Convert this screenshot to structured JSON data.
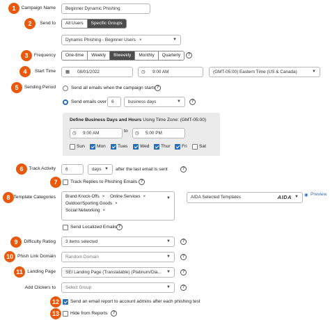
{
  "labels": {
    "campaign_name": "Campaign Name",
    "send_to": "Send to",
    "frequency": "Frequency",
    "start_time": "Start Time",
    "sending_period": "Sending Period",
    "track_activity": "Track Activity",
    "template_categories": "Template Categories",
    "difficulty_rating": "Difficulty Rating",
    "phish_link_domain": "Phish Link Domain",
    "landing_page": "Landing Page",
    "add_clickers_to": "Add Clickers to"
  },
  "badges": [
    "1",
    "2",
    "3",
    "4",
    "5",
    "6",
    "7",
    "8",
    "9",
    "10",
    "11",
    "12",
    "13"
  ],
  "campaign_name": {
    "value": "Beginner Dynamic Phishing"
  },
  "send_to": {
    "options": [
      "All Users",
      "Specific Groups"
    ],
    "selected": "Specific Groups",
    "group_chip": "Dynamic Phishing - Beginner Users",
    "remove_glyph": "×"
  },
  "frequency": {
    "options": [
      "One-time",
      "Weekly",
      "Biweekly",
      "Monthly",
      "Quarterly"
    ],
    "selected": "Biweekly"
  },
  "help_glyph": "?",
  "start_time": {
    "date": "08/01/2022",
    "time": "9:00 AM",
    "timezone": "(GMT-05:00) Eastern Time (US & Canada)"
  },
  "sending_period": {
    "option_all": "Send all emails when the campaign starts",
    "option_over": "Send emails over",
    "over_value": "6",
    "unit": "business days",
    "panel_title": "Define Business Days and Hours",
    "panel_timezone": "Using Time Zone: (GMT-05:00)",
    "from_time": "9:00 AM",
    "to_label": "to",
    "to_time": "5:00 PM",
    "days": [
      {
        "label": "Sun",
        "checked": false
      },
      {
        "label": "Mon",
        "checked": true
      },
      {
        "label": "Tues",
        "checked": true
      },
      {
        "label": "Wed",
        "checked": true
      },
      {
        "label": "Thur",
        "checked": true
      },
      {
        "label": "Fri",
        "checked": true
      },
      {
        "label": "Sat",
        "checked": false
      }
    ]
  },
  "track_activity": {
    "value": "6",
    "unit": "days",
    "suffix": "after the last email is sent"
  },
  "track_replies": {
    "label": "Track Replies to Phishing Emails"
  },
  "template_categories": {
    "chips": [
      "Brand Knock-Offs",
      "Online Services",
      "Outdoor/Sporting Goods",
      "Social Networking"
    ],
    "aida_label": "AIDA Selected Templates",
    "aida_logo": "AIDA",
    "preview": "Preview"
  },
  "send_localized": {
    "label": "Send Localized Emails"
  },
  "difficulty_rating": {
    "value": "3 items selected"
  },
  "phish_link_domain": {
    "placeholder": "Random Domain"
  },
  "landing_page": {
    "value": "SEI Landing Page (Translatable) (Platinum/Dia..."
  },
  "add_clickers_to": {
    "placeholder": "Select Group"
  },
  "email_report": {
    "label": "Send an email report to account admins after each phishing test"
  },
  "hide_reports": {
    "label": "Hide from Reports"
  },
  "colors": {
    "badge": "#e8590c",
    "accent": "#2a6ebb",
    "segment_active": "#4d4d4d"
  }
}
